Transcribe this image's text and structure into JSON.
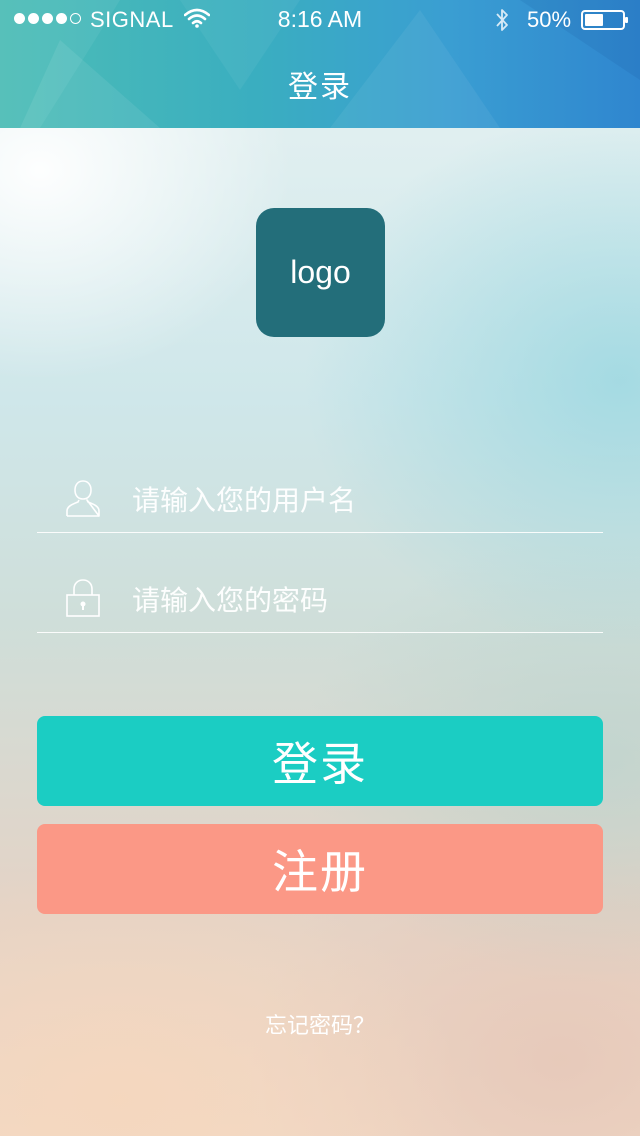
{
  "status_bar": {
    "carrier": "SIGNAL",
    "time": "8:16 AM",
    "battery_percent": "50%",
    "battery_level": 0.5,
    "signal_bars_filled": 4,
    "signal_bars_total": 5
  },
  "nav": {
    "title": "登录"
  },
  "logo": {
    "text": "logo",
    "color": "#236e7a"
  },
  "form": {
    "username_placeholder": "请输入您的用户名",
    "password_placeholder": "请输入您的密码",
    "username_icon": "user-icon",
    "password_icon": "lock-icon"
  },
  "buttons": {
    "login_label": "登录",
    "login_color": "#1bcdc3",
    "register_label": "注册",
    "register_color": "#fb9886"
  },
  "links": {
    "forgot_password": "忘记密码？"
  }
}
